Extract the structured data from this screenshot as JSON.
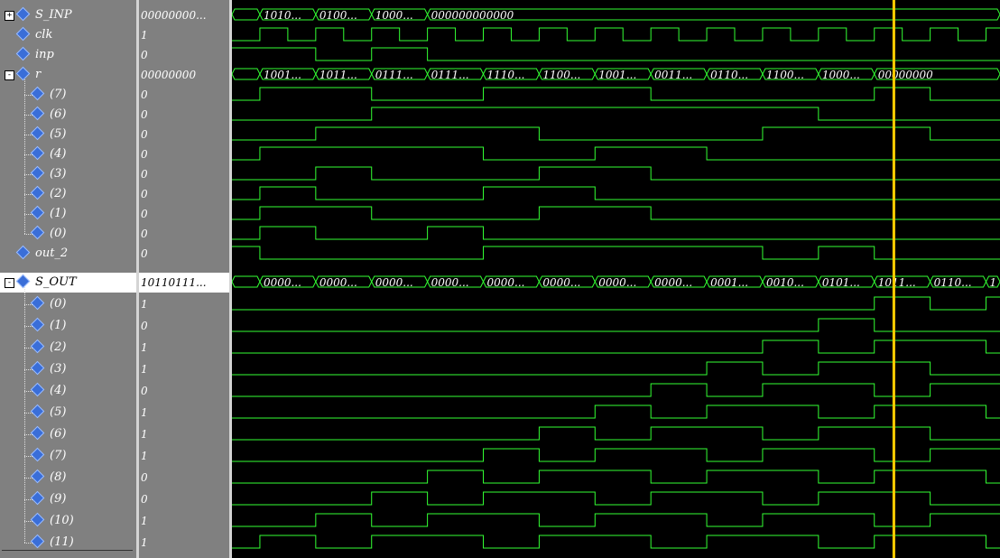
{
  "signals": [
    {
      "name": "S_INP",
      "value": "00000000...",
      "type": "bus",
      "expand": "+",
      "indent": 0,
      "selected": false,
      "segments": [
        {
          "t0": 0,
          "t1": 1,
          "label": ""
        },
        {
          "t0": 1,
          "t1": 3,
          "label": "1010..."
        },
        {
          "t0": 3,
          "t1": 5,
          "label": "0100..."
        },
        {
          "t0": 5,
          "t1": 7,
          "label": "1000..."
        },
        {
          "t0": 7,
          "t1": 27.5,
          "label": "000000000000"
        }
      ]
    },
    {
      "name": "clk",
      "value": "1",
      "type": "clock",
      "indent": 0
    },
    {
      "name": "inp",
      "value": "0",
      "type": "bit",
      "indent": 0,
      "transitions": [
        0,
        1,
        3,
        0,
        5,
        1,
        7,
        0
      ]
    },
    {
      "name": "r",
      "value": "00000000",
      "type": "bus",
      "expand": "-",
      "indent": 0,
      "selected": false,
      "segments": [
        {
          "t0": 0,
          "t1": 1,
          "label": ""
        },
        {
          "t0": 1,
          "t1": 3,
          "label": "1001..."
        },
        {
          "t0": 3,
          "t1": 5,
          "label": "1011..."
        },
        {
          "t0": 5,
          "t1": 7,
          "label": "0111..."
        },
        {
          "t0": 7,
          "t1": 9,
          "label": "0111..."
        },
        {
          "t0": 9,
          "t1": 11,
          "label": "1110..."
        },
        {
          "t0": 11,
          "t1": 13,
          "label": "1100..."
        },
        {
          "t0": 13,
          "t1": 15,
          "label": "1001..."
        },
        {
          "t0": 15,
          "t1": 17,
          "label": "0011..."
        },
        {
          "t0": 17,
          "t1": 19,
          "label": "0110..."
        },
        {
          "t0": 19,
          "t1": 21,
          "label": "1100..."
        },
        {
          "t0": 21,
          "t1": 23,
          "label": "1000..."
        },
        {
          "t0": 23,
          "t1": 27.5,
          "label": "00000000"
        }
      ]
    },
    {
      "name": "(7)",
      "value": "0",
      "type": "bit",
      "indent": 1,
      "transitions": [
        0,
        0,
        1,
        1,
        5,
        0,
        9,
        1,
        15,
        0,
        23,
        1,
        25,
        0
      ]
    },
    {
      "name": "(6)",
      "value": "0",
      "type": "bit",
      "indent": 1,
      "transitions": [
        0,
        0,
        5,
        1,
        21,
        0
      ]
    },
    {
      "name": "(5)",
      "value": "0",
      "type": "bit",
      "indent": 1,
      "transitions": [
        0,
        0,
        3,
        1,
        11,
        0,
        19,
        1,
        25,
        0
      ]
    },
    {
      "name": "(4)",
      "value": "0",
      "type": "bit",
      "indent": 1,
      "transitions": [
        0,
        0,
        1,
        1,
        9,
        0,
        13,
        1,
        17,
        0
      ]
    },
    {
      "name": "(3)",
      "value": "0",
      "type": "bit",
      "indent": 1,
      "transitions": [
        0,
        0,
        3,
        1,
        5,
        0,
        11,
        1,
        15,
        0
      ]
    },
    {
      "name": "(2)",
      "value": "0",
      "type": "bit",
      "indent": 1,
      "transitions": [
        0,
        0,
        1,
        1,
        3,
        0,
        9,
        1,
        13,
        0
      ]
    },
    {
      "name": "(1)",
      "value": "0",
      "type": "bit",
      "indent": 1,
      "transitions": [
        0,
        0,
        1,
        1,
        5,
        0,
        11,
        1,
        15,
        0
      ]
    },
    {
      "name": "(0)",
      "value": "0",
      "type": "bit",
      "indent": 1,
      "transitions": [
        0,
        0,
        1,
        1,
        3,
        0,
        7,
        1,
        9,
        0
      ]
    },
    {
      "name": "out_2",
      "value": "0",
      "type": "bit",
      "indent": 0,
      "transitions": [
        0,
        1,
        1,
        0,
        9,
        1,
        19,
        0,
        21,
        1,
        23,
        0
      ]
    },
    {
      "name": "S_OUT",
      "value": "10110111...",
      "type": "bus",
      "expand": "-",
      "indent": 0,
      "selected": true,
      "segments": [
        {
          "t0": 0,
          "t1": 1,
          "label": ""
        },
        {
          "t0": 1,
          "t1": 3,
          "label": "0000..."
        },
        {
          "t0": 3,
          "t1": 5,
          "label": "0000..."
        },
        {
          "t0": 5,
          "t1": 7,
          "label": "0000..."
        },
        {
          "t0": 7,
          "t1": 9,
          "label": "0000..."
        },
        {
          "t0": 9,
          "t1": 11,
          "label": "0000..."
        },
        {
          "t0": 11,
          "t1": 13,
          "label": "0000..."
        },
        {
          "t0": 13,
          "t1": 15,
          "label": "0000..."
        },
        {
          "t0": 15,
          "t1": 17,
          "label": "0000..."
        },
        {
          "t0": 17,
          "t1": 19,
          "label": "0001..."
        },
        {
          "t0": 19,
          "t1": 21,
          "label": "0010..."
        },
        {
          "t0": 21,
          "t1": 23,
          "label": "0101..."
        },
        {
          "t0": 23,
          "t1": 25,
          "label": "1011..."
        },
        {
          "t0": 25,
          "t1": 27,
          "label": "0110..."
        },
        {
          "t0": 27,
          "t1": 27.5,
          "label": "1"
        }
      ]
    },
    {
      "name": "(0)",
      "value": "1",
      "type": "bit",
      "indent": 1,
      "transitions": [
        0,
        0,
        23,
        1,
        25,
        0,
        27,
        1
      ]
    },
    {
      "name": "(1)",
      "value": "0",
      "type": "bit",
      "indent": 1,
      "transitions": [
        0,
        0,
        21,
        1,
        23,
        0
      ]
    },
    {
      "name": "(2)",
      "value": "1",
      "type": "bit",
      "indent": 1,
      "transitions": [
        0,
        0,
        19,
        1,
        21,
        0,
        23,
        1,
        27,
        0
      ]
    },
    {
      "name": "(3)",
      "value": "1",
      "type": "bit",
      "indent": 1,
      "transitions": [
        0,
        0,
        17,
        1,
        19,
        0,
        21,
        1,
        25,
        0
      ]
    },
    {
      "name": "(4)",
      "value": "0",
      "type": "bit",
      "indent": 1,
      "transitions": [
        0,
        0,
        15,
        1,
        17,
        0,
        19,
        1,
        23,
        0,
        25,
        1
      ]
    },
    {
      "name": "(5)",
      "value": "1",
      "type": "bit",
      "indent": 1,
      "transitions": [
        0,
        0,
        13,
        1,
        15,
        0,
        17,
        1,
        21,
        0,
        23,
        1,
        27,
        0
      ]
    },
    {
      "name": "(6)",
      "value": "1",
      "type": "bit",
      "indent": 1,
      "transitions": [
        0,
        0,
        11,
        1,
        13,
        0,
        15,
        1,
        19,
        0,
        21,
        1,
        25,
        0
      ]
    },
    {
      "name": "(7)",
      "value": "1",
      "type": "bit",
      "indent": 1,
      "transitions": [
        0,
        0,
        9,
        1,
        11,
        0,
        13,
        1,
        17,
        0,
        19,
        1,
        23,
        0,
        25,
        1
      ]
    },
    {
      "name": "(8)",
      "value": "0",
      "type": "bit",
      "indent": 1,
      "transitions": [
        0,
        0,
        7,
        1,
        9,
        0,
        11,
        1,
        15,
        0,
        17,
        1,
        21,
        0,
        23,
        1,
        27,
        0
      ]
    },
    {
      "name": "(9)",
      "value": "0",
      "type": "bit",
      "indent": 1,
      "transitions": [
        0,
        0,
        5,
        1,
        7,
        0,
        9,
        1,
        13,
        0,
        15,
        1,
        19,
        0,
        21,
        1,
        25,
        0
      ]
    },
    {
      "name": "(10)",
      "value": "1",
      "type": "bit",
      "indent": 1,
      "transitions": [
        0,
        0,
        3,
        1,
        5,
        0,
        7,
        1,
        11,
        0,
        13,
        1,
        17,
        0,
        19,
        1,
        23,
        0,
        25,
        1
      ]
    },
    {
      "name": "(11)",
      "value": "1",
      "type": "bit",
      "indent": 1,
      "transitions": [
        0,
        0,
        1,
        1,
        3,
        0,
        5,
        1,
        9,
        0,
        11,
        1,
        15,
        0,
        17,
        1,
        21,
        0,
        23,
        1,
        27,
        0
      ]
    }
  ],
  "colors": {
    "wave": "#33ff33",
    "cursor": "#ffcc00",
    "bus_text": "#ffffff",
    "panel": "#808080"
  },
  "cursor_time": 23.7
}
